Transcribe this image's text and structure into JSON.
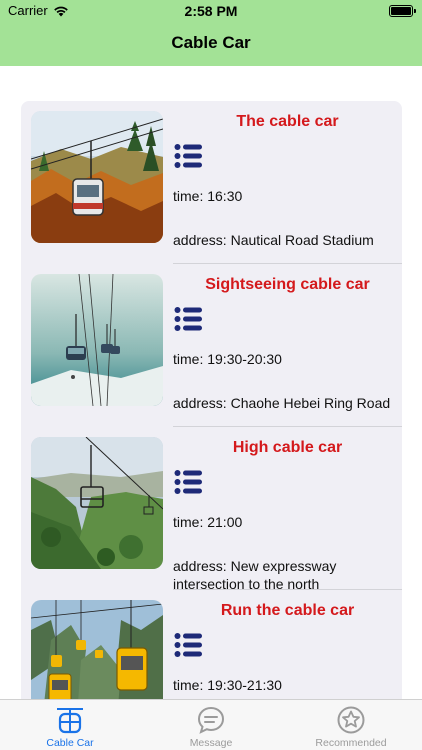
{
  "status_bar": {
    "carrier": "Carrier",
    "time": "2:58 PM"
  },
  "nav": {
    "title": "Cable Car"
  },
  "items": [
    {
      "title": "The cable car",
      "time": "time: 16:30",
      "address": "address: Nautical Road Stadium"
    },
    {
      "title": "Sightseeing cable car",
      "time": "time: 19:30-20:30",
      "address": "address:  Chaohe Hebei Ring Road"
    },
    {
      "title": "High cable car",
      "time": "time: 21:00",
      "address": "address: New expressway intersection to the north"
    },
    {
      "title": "Run the cable car",
      "time": "time: 19:30-21:30",
      "address": ""
    }
  ],
  "tabs": [
    {
      "label": "Cable Car",
      "icon": "cable-car-icon",
      "active": true
    },
    {
      "label": "Message",
      "icon": "message-icon",
      "active": false
    },
    {
      "label": "Recommended",
      "icon": "recommended-icon",
      "active": false
    }
  ],
  "colors": {
    "header": "#a3e296",
    "title_red": "#d4191c",
    "icon_navy": "#1e2a78",
    "tab_active": "#1a73e8"
  }
}
